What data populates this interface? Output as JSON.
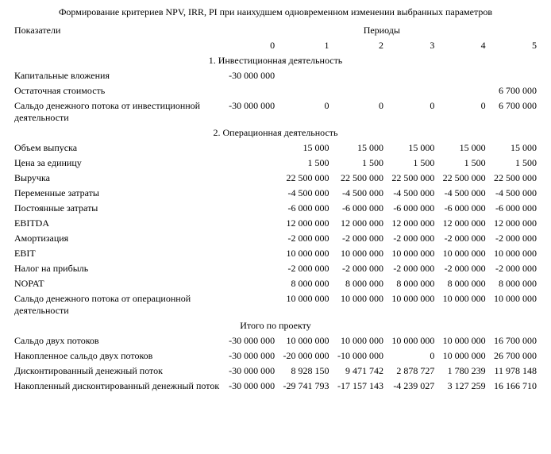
{
  "title": "Формирование критериев NPV, IRR, PI при наихудшем одновременном изменении выбранных параметров",
  "header": {
    "indicators": "Показатели",
    "periods": "Периоды",
    "cols": [
      "0",
      "1",
      "2",
      "3",
      "4",
      "5"
    ]
  },
  "section1": "1. Инвестиционная деятельность",
  "rows1": {
    "capex": {
      "label": "Капитальные вложения",
      "v": [
        "-30 000 000",
        "",
        "",
        "",
        "",
        ""
      ]
    },
    "liquid": {
      "label": "Остаточная стоимость",
      "v": [
        "",
        "",
        "",
        "",
        "",
        "6 700 000"
      ]
    },
    "saldo_inv": {
      "label": "Сальдо денежного потока от инвестиционной деятельности",
      "v": [
        "-30 000 000",
        "0",
        "0",
        "0",
        "0",
        "6 700 000"
      ]
    }
  },
  "section2": "2. Операционная деятельность",
  "rows2": {
    "volume": {
      "label": "Объем выпуска",
      "v": [
        "",
        "15 000",
        "15 000",
        "15 000",
        "15 000",
        "15 000"
      ]
    },
    "price": {
      "label": "Цена за единицу",
      "v": [
        "",
        "1 500",
        "1 500",
        "1 500",
        "1 500",
        "1 500"
      ]
    },
    "revenue": {
      "label": "Выручка",
      "v": [
        "",
        "22 500 000",
        "22 500 000",
        "22 500 000",
        "22 500 000",
        "22 500 000"
      ]
    },
    "varcost": {
      "label": "Переменные затраты",
      "v": [
        "",
        "-4 500 000",
        "-4 500 000",
        "-4 500 000",
        "-4 500 000",
        "-4 500 000"
      ]
    },
    "fixcost": {
      "label": "Постоянные затраты",
      "v": [
        "",
        "-6 000 000",
        "-6 000 000",
        "-6 000 000",
        "-6 000 000",
        "-6 000 000"
      ]
    },
    "ebitda": {
      "label": "EBITDA",
      "v": [
        "",
        "12 000 000",
        "12 000 000",
        "12 000 000",
        "12 000 000",
        "12 000 000"
      ]
    },
    "deprec": {
      "label": "Амортизация",
      "v": [
        "",
        "-2 000 000",
        "-2 000 000",
        "-2 000 000",
        "-2 000 000",
        "-2 000 000"
      ]
    },
    "ebit": {
      "label": "EBIT",
      "v": [
        "",
        "10 000 000",
        "10 000 000",
        "10 000 000",
        "10 000 000",
        "10 000 000"
      ]
    },
    "tax": {
      "label": "Налог на прибыль",
      "v": [
        "",
        "-2 000 000",
        "-2 000 000",
        "-2 000 000",
        "-2 000 000",
        "-2 000 000"
      ]
    },
    "nopat": {
      "label": "NOPAT",
      "v": [
        "",
        "8 000 000",
        "8 000 000",
        "8 000 000",
        "8 000 000",
        "8 000 000"
      ]
    },
    "saldo_op": {
      "label": "Сальдо денежного потока от операционной деятельности",
      "v": [
        "",
        "10 000 000",
        "10 000 000",
        "10 000 000",
        "10 000 000",
        "10 000 000"
      ]
    }
  },
  "section3": "Итого по проекту",
  "rows3": {
    "saldo": {
      "label": "Сальдо двух потоков",
      "v": [
        "-30 000 000",
        "10 000 000",
        "10 000 000",
        "10 000 000",
        "10 000 000",
        "16 700 000"
      ]
    },
    "cum": {
      "label": "Накопленное сальдо двух потоков",
      "v": [
        "-30 000 000",
        "-20 000 000",
        "-10 000 000",
        "0",
        "10 000 000",
        "26 700 000"
      ]
    },
    "disc": {
      "label": "Дисконтированный денежный поток",
      "v": [
        "-30 000 000",
        "8 928 150",
        "9 471 742",
        "2 878 727",
        "1 780 239",
        "11 978 148"
      ]
    },
    "cumdisc": {
      "label": "Накопленный дисконтированный денежный поток",
      "v": [
        "-30 000 000",
        "-29 741 793",
        "-17 157 143",
        "-4 239 027",
        "3 127 259",
        "16 166 710"
      ]
    }
  }
}
